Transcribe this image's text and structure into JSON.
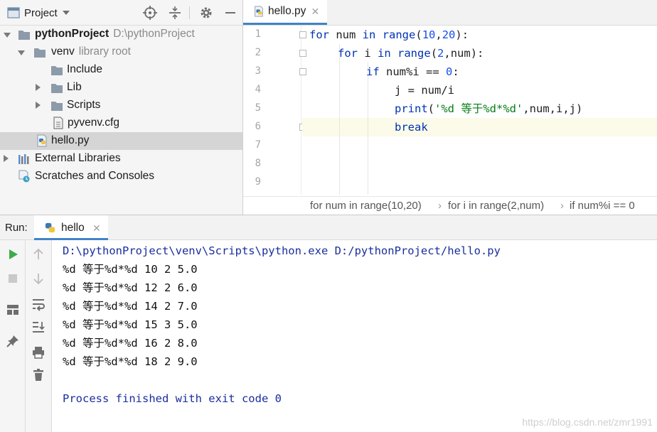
{
  "project_panel": {
    "title": "Project",
    "tree": [
      {
        "label": "pythonProject",
        "hint": "D:\\pythonProject"
      },
      {
        "label": "venv",
        "hint": "library root"
      },
      {
        "label": "Include"
      },
      {
        "label": "Lib"
      },
      {
        "label": "Scripts"
      },
      {
        "label": "pyvenv.cfg"
      },
      {
        "label": "hello.py"
      },
      {
        "label": "External Libraries"
      },
      {
        "label": "Scratches and Consoles"
      }
    ]
  },
  "editor": {
    "tab_label": "hello.py",
    "line_numbers": [
      "1",
      "2",
      "3",
      "4",
      "5",
      "6",
      "7",
      "8",
      "9"
    ],
    "code": {
      "l1": {
        "kw1": "for",
        "t1": " num ",
        "kw2": "in",
        "t2": " ",
        "fn": "range",
        "t3": "(",
        "n1": "10",
        "t4": ",",
        "n2": "20",
        "t5": "):"
      },
      "l2": {
        "kw1": "for",
        "t1": " i ",
        "kw2": "in",
        "t2": " ",
        "fn": "range",
        "t3": "(",
        "n1": "2",
        "t4": ",num):"
      },
      "l3": {
        "kw1": "if",
        "t1": " num%i == ",
        "n1": "0",
        "t2": ":"
      },
      "l4": {
        "t1": "j = num/i"
      },
      "l5": {
        "fn": "print",
        "t1": "(",
        "s1": "'%d 等于%d*%d'",
        "t2": ",num,i,j)"
      },
      "l6": {
        "kw1": "break"
      }
    },
    "breadcrumbs": [
      "for num in range(10,20)",
      "for i in range(2,num)",
      "if num%i == 0"
    ]
  },
  "run_panel": {
    "label": "Run:",
    "tab_label": "hello",
    "console": [
      "D:\\pythonProject\\venv\\Scripts\\python.exe D:/pythonProject/hello.py",
      "%d 等于%d*%d 10 2 5.0",
      "%d 等于%d*%d 12 2 6.0",
      "%d 等于%d*%d 14 2 7.0",
      "%d 等于%d*%d 15 3 5.0",
      "%d 等于%d*%d 16 2 8.0",
      "%d 等于%d*%d 18 2 9.0",
      "Process finished with exit code 0"
    ],
    "watermark": "https://blog.csdn.net/zmr1991"
  },
  "colors": {
    "keyword": "#0033b3",
    "number": "#1750eb",
    "string": "#067d17",
    "tab_underline": "#4083c9",
    "run_green": "#3dab4a",
    "console_blue": "#1a2e9e"
  },
  "icons": [
    "project-view-icon",
    "dropdown-arrow-icon",
    "locate-icon",
    "collapse-icon",
    "gear-icon",
    "minimize-icon",
    "folder-icon",
    "python-file-icon",
    "config-file-icon",
    "libraries-icon",
    "scratches-icon",
    "run-icon",
    "stop-icon",
    "layout-icon",
    "pin-icon",
    "up-arrow-icon",
    "down-arrow-icon",
    "soft-wrap-icon",
    "scroll-to-end-icon",
    "print-icon",
    "trash-icon"
  ]
}
